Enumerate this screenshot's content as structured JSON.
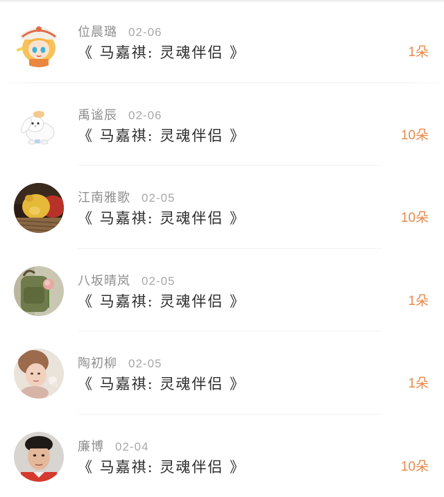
{
  "entries": [
    {
      "name": "位晨璐",
      "date": "02-06",
      "book": "《 马嘉祺:  灵魂伴侣 》",
      "count": "1朵",
      "avatar": "anime-girl-avatar"
    },
    {
      "name": "禹谧辰",
      "date": "02-06",
      "book": "《 马嘉祺:  灵魂伴侣 》",
      "count": "10朵",
      "avatar": "bunny-avatar"
    },
    {
      "name": "江南雅歌",
      "date": "02-05",
      "book": "《 马嘉祺:  灵魂伴侣 》",
      "count": "10朵",
      "avatar": "plush-bear-avatar"
    },
    {
      "name": "八坂晴岚",
      "date": "02-05",
      "book": "《 马嘉祺:  灵魂伴侣 》",
      "count": "1朵",
      "avatar": "backpack-flower-avatar"
    },
    {
      "name": "陶初柳",
      "date": "02-05",
      "book": "《 马嘉祺:  灵魂伴侣 》",
      "count": "1朵",
      "avatar": "child-portrait-avatar"
    },
    {
      "name": "廉博",
      "date": "02-04",
      "book": "《 马嘉祺:  灵魂伴侣 》",
      "count": "10朵",
      "avatar": "man-portrait-avatar"
    }
  ]
}
